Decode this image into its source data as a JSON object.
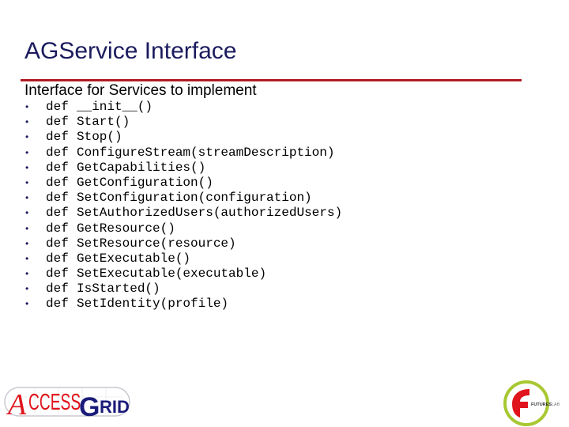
{
  "slide": {
    "title": "AGService Interface",
    "subtitle": "Interface for Services to implement",
    "accent_color": "#b01c22",
    "title_color": "#1b1b5e",
    "keyword": "def",
    "methods": [
      "__init__()",
      "Start()",
      "Stop()",
      "ConfigureStream(streamDescription)",
      "GetCapabilities()",
      "GetConfiguration()",
      "SetConfiguration(configuration)",
      "SetAuthorizedUsers(authorizedUsers)",
      "GetResource()",
      "SetResource(resource)",
      "GetExecutable()",
      "SetExecutable(executable)",
      "IsStarted()",
      "SetIdentity(profile)"
    ]
  },
  "logos": {
    "left": {
      "part1": "ACCESS",
      "part2": "GRID"
    },
    "right": {
      "part1": "FUTURES",
      "part2": "LAB"
    }
  }
}
